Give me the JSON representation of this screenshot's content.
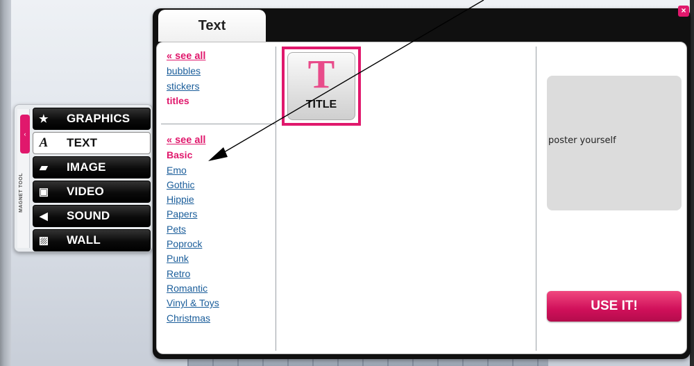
{
  "magnet_tool": {
    "collapse_glyph": "‹",
    "label": "MAGNET TOOL",
    "items": [
      {
        "label": "GRAPHICS",
        "icon": "star-icon",
        "glyph": "★",
        "active": false
      },
      {
        "label": "TEXT",
        "icon": "text-icon",
        "glyph": "A",
        "active": true
      },
      {
        "label": "IMAGE",
        "icon": "image-icon",
        "glyph": "▰",
        "active": false
      },
      {
        "label": "VIDEO",
        "icon": "film-icon",
        "glyph": "▣",
        "active": false
      },
      {
        "label": "SOUND",
        "icon": "speaker-icon",
        "glyph": "◀",
        "active": false
      },
      {
        "label": "WALL",
        "icon": "wall-icon",
        "glyph": "▨",
        "active": false
      }
    ]
  },
  "panel": {
    "tab_label": "Text",
    "close_glyph": "×",
    "categories": {
      "see_all": "« see all",
      "items": [
        "bubbles",
        "stickers",
        "titles"
      ],
      "current": "titles"
    },
    "styles": {
      "see_all": "« see all",
      "current": "Basic",
      "items": [
        "Emo",
        "Gothic",
        "Hippie",
        "Papers",
        "Pets",
        "Poprock",
        "Punk",
        "Retro",
        "Romantic",
        "Vinyl & Toys",
        "Christmas"
      ]
    },
    "thumbnail": {
      "glyph": "T",
      "label": "TITLE"
    },
    "preview_text": "poster yourself",
    "use_button": "USE IT!"
  },
  "colors": {
    "accent": "#e0186c",
    "link": "#1a5d9a"
  }
}
